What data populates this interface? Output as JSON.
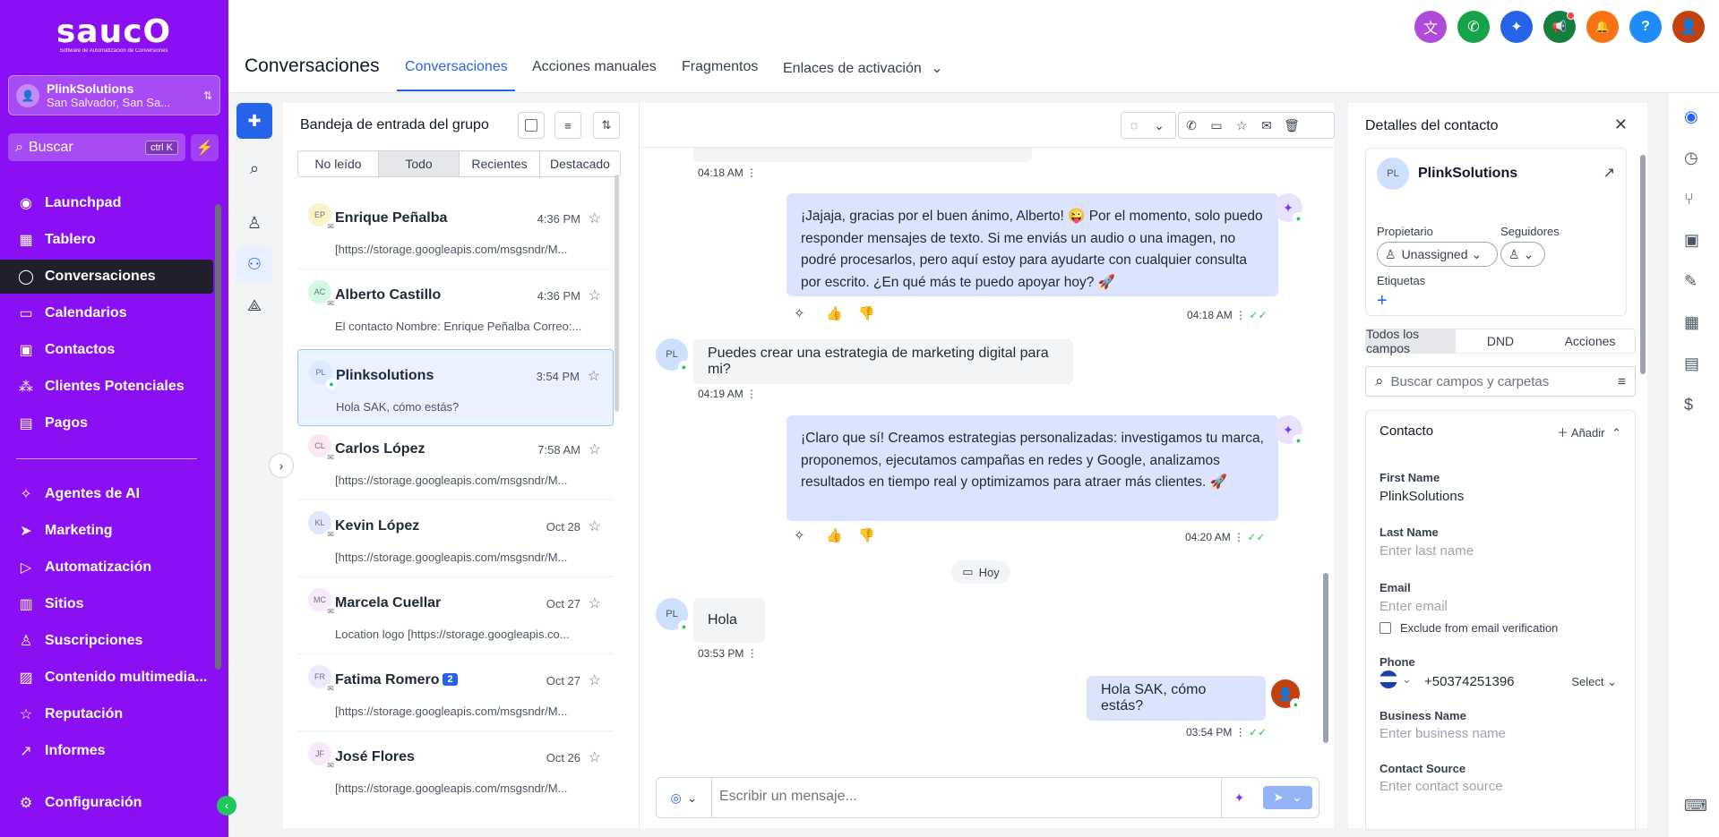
{
  "brand": {
    "logo_text": "saucO",
    "tagline": "Software de Automatización de Conversiones"
  },
  "location": {
    "initial": "👤",
    "name": "PlinkSolutions",
    "address": "San Salvador, San Sa..."
  },
  "search": {
    "placeholder": "Buscar",
    "shortcut": "ctrl K",
    "bolt_icon": "lightning-icon"
  },
  "sidebar": {
    "items": [
      {
        "label": "Launchpad",
        "icon": "◉"
      },
      {
        "label": "Tablero",
        "icon": "▦"
      },
      {
        "label": "Conversaciones",
        "icon": "◯"
      },
      {
        "label": "Calendarios",
        "icon": "▭"
      },
      {
        "label": "Contactos",
        "icon": "▣"
      },
      {
        "label": "Clientes Potenciales",
        "icon": "⁂"
      },
      {
        "label": "Pagos",
        "icon": "▤"
      },
      {
        "label": "Agentes de AI",
        "icon": "✧"
      },
      {
        "label": "Marketing",
        "icon": "➤"
      },
      {
        "label": "Automatización",
        "icon": "▷"
      },
      {
        "label": "Sitios",
        "icon": "▥"
      },
      {
        "label": "Suscripciones",
        "icon": "♙"
      },
      {
        "label": "Contenido multimedia...",
        "icon": "▨"
      },
      {
        "label": "Reputación",
        "icon": "☆"
      },
      {
        "label": "Informes",
        "icon": "↗"
      },
      {
        "label": "Configuración",
        "icon": "⚙"
      }
    ],
    "collapse_icon": "‹"
  },
  "header": {
    "title": "Conversaciones",
    "tabs": [
      "Conversaciones",
      "Acciones manuales",
      "Fragmentos",
      "Enlaces de activación"
    ],
    "tab_dropdown": "⌄"
  },
  "top_icons": [
    {
      "name": "translate-icon",
      "glyph": "文",
      "color": "#b04ad9"
    },
    {
      "name": "phone-icon",
      "glyph": "✆",
      "color": "#16a34a"
    },
    {
      "name": "ai-sparkle-icon",
      "glyph": "✦",
      "color": "#2563eb"
    },
    {
      "name": "megaphone-icon",
      "glyph": "📢",
      "color": "#15803d"
    },
    {
      "name": "bell-icon",
      "glyph": "🔔",
      "color": "#f97316"
    },
    {
      "name": "help-icon",
      "glyph": "?",
      "color": "#1d8cf8"
    },
    {
      "name": "user-avatar-icon",
      "glyph": "👤",
      "color": "#c2410c"
    }
  ],
  "inbox": {
    "title": "Bandeja de entrada del grupo",
    "filters": [
      "No leído",
      "Todo",
      "Recientes",
      "Destacado"
    ],
    "conversations": [
      {
        "initials": "EP",
        "color": "#fef3c7",
        "name": "Enrique Peñalba",
        "badge": "",
        "time": "4:36 PM",
        "preview": "[https://storage.googleapis.com/msgsndr/M...",
        "channel": "✉"
      },
      {
        "initials": "AC",
        "color": "#d1fae5",
        "name": "Alberto Castillo",
        "badge": "",
        "time": "4:36 PM",
        "preview": "El contacto Nombre: Enrique Peñalba Correo:...",
        "channel": "✉"
      },
      {
        "initials": "PL",
        "color": "#dbeafe",
        "name": "Plinksolutions",
        "badge": "",
        "time": "3:54 PM",
        "preview": "Hola SAK, cómo estás?",
        "channel": "●"
      },
      {
        "initials": "CL",
        "color": "#fce7f3",
        "name": "Carlos López",
        "badge": "",
        "time": "7:58 AM",
        "preview": "[https://storage.googleapis.com/msgsndr/M...",
        "channel": "✉"
      },
      {
        "initials": "KL",
        "color": "#e0e7ff",
        "name": "Kevin López",
        "badge": "",
        "time": "Oct 28",
        "preview": "[https://storage.googleapis.com/msgsndr/M...",
        "channel": "✉"
      },
      {
        "initials": "MC",
        "color": "#fae8ff",
        "name": "Marcela Cuellar",
        "badge": "",
        "time": "Oct 27",
        "preview": "Location logo [https://storage.googleapis.co...",
        "channel": "✉"
      },
      {
        "initials": "FR",
        "color": "#ede9fe",
        "name": "Fatima Romero",
        "badge": "2",
        "time": "Oct 27",
        "preview": "[https://storage.googleapis.com/msgsndr/M...",
        "channel": "✉"
      },
      {
        "initials": "JF",
        "color": "#fae8ff",
        "name": "José Flores",
        "badge": "",
        "time": "Oct 26",
        "preview": "[https://storage.googleapis.com/msgsndr/M...",
        "channel": "✉"
      }
    ]
  },
  "chat": {
    "messages": {
      "t0": "04:18 AM",
      "out1": "¡Jajaja, gracias por el buen ánimo, Alberto! 😜 Por el momento, solo puedo responder mensajes de texto. Si me enviás un audio o una imagen, no podré procesarlos, pero aquí estoy para ayudarte con cualquier consulta por escrito. ¿En qué más te puedo apoyar hoy? 🚀",
      "out1_time": "04:18 AM",
      "in1": "Puedes crear una estrategia de marketing digital para mi?",
      "in1_time": "04:19 AM",
      "out2": "¡Claro que sí! Creamos estrategias personalizadas: investigamos tu marca, proponemos, ejecutamos campañas en redes y Google, analizamos resultados en tiempo real y optimizamos para atraer más clientes. 🚀",
      "out2_time": "04:20 AM",
      "day": "Hoy",
      "in2": "Hola",
      "in2_time": "03:53 PM",
      "out3": "Hola SAK, cómo estás?",
      "out3_time": "03:54 PM"
    },
    "contact_initials": "PL",
    "composer_placeholder": "Escribir un mensaje..."
  },
  "details": {
    "title": "Detalles del contacto",
    "contact_initials": "PL",
    "contact_name": "PlinkSolutions",
    "owner_label": "Propietario",
    "owner_value": "Unassigned",
    "followers_label": "Seguidores",
    "tags_label": "Etiquetas",
    "tabs": [
      "Todos los campos",
      "DND",
      "Acciones"
    ],
    "search_placeholder": "Buscar campos y carpetas",
    "section_title": "Contacto",
    "add_label": "Añadir",
    "first_name_label": "First Name",
    "first_name_value": "PlinkSolutions",
    "last_name_label": "Last Name",
    "last_name_placeholder": "Enter last name",
    "email_label": "Email",
    "email_placeholder": "Enter email",
    "exclude_label": "Exclude from email verification",
    "phone_label": "Phone",
    "phone_value": "+50374251396",
    "phone_select": "Select",
    "business_label": "Business Name",
    "business_placeholder": "Enter business name",
    "source_label": "Contact Source",
    "source_placeholder": "Enter contact source"
  }
}
